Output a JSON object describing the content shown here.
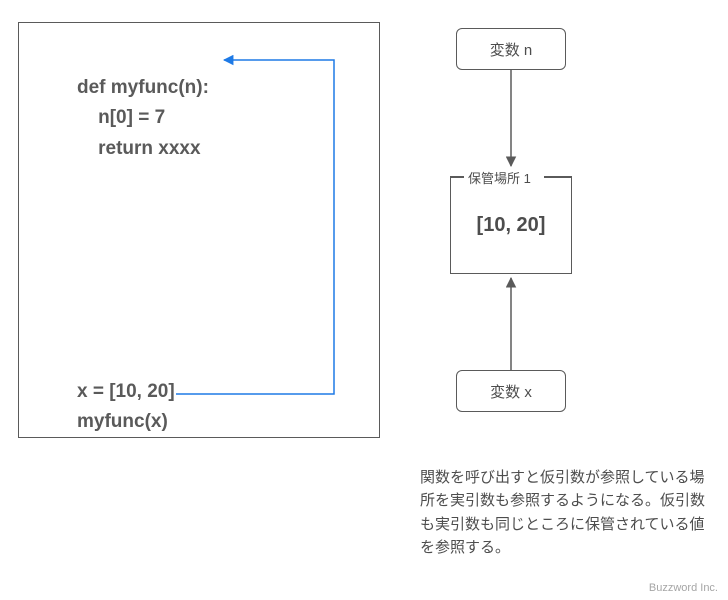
{
  "code": {
    "line1": "def myfunc(n):",
    "line2": "    n[0] = 7",
    "line3": "    return xxxx",
    "line4": "x = [10, 20]",
    "line5": "myfunc(x)"
  },
  "variables": {
    "n_label": "変数 n",
    "x_label": "変数  x"
  },
  "storage": {
    "title": "保管場所 1",
    "value": "[10, 20]"
  },
  "caption": "関数を呼び出すと仮引数が参照している場所を実引数も参照するようになる。仮引数も実引数も同じところに保管されている値を参照する。",
  "credit": "Buzzword Inc."
}
